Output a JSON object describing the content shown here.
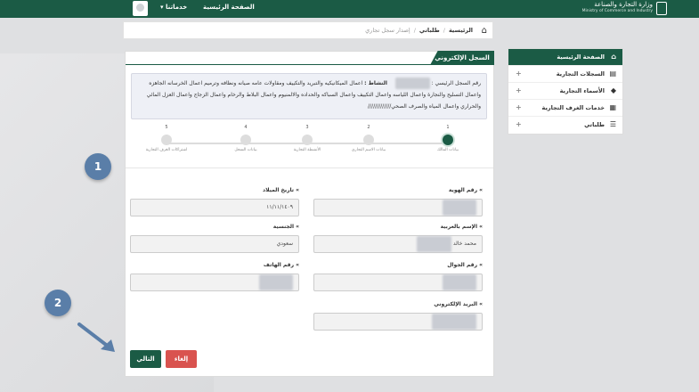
{
  "topbar": {
    "ministry_ar": "وزارة التجارة والصناعة",
    "ministry_en": "Ministry of Commerce and Industry",
    "home_label": "الصفحة الرئيسية",
    "user_menu_label": "خدماتنا"
  },
  "breadcrumb": {
    "items": [
      "الرئيسية",
      "طلباتي",
      "إصدار سجل تجاري"
    ]
  },
  "sidebar": {
    "items": [
      {
        "label": "الصفحة الرئيسية"
      },
      {
        "label": "السجلات التجارية"
      },
      {
        "label": "الأسماء التجارية"
      },
      {
        "label": "خدمات الغرف التجارية"
      },
      {
        "label": "طلباتي"
      }
    ]
  },
  "panel": {
    "title": "السجل الإلكتروني",
    "info": {
      "cr_label": "رقم السجل الرئيسي :",
      "activity_label": "النشاط :",
      "activity_text": "اعمال الميكانيكيه والتبريد والتكييف ومقاولات عامه صيانه ونظافه وترميم اعمال الخرسانه الجاهزه واعمال التسليح والنجارة واعمال اللياسه واعمال التكييف واعمال السباكه والحداده والالمنيوم واعمال البلاط والرخام واعمال الزجاج واعمال العزل المائي والحراري واعمال المياه والصرف الصحي"
    },
    "steps": [
      {
        "num": "1",
        "label": "بيانات المالك"
      },
      {
        "num": "2",
        "label": "بيانات الاسم التجاري"
      },
      {
        "num": "3",
        "label": "الأنشطة التجارية"
      },
      {
        "num": "4",
        "label": "بيانات السجل"
      },
      {
        "num": "5",
        "label": "اشتراكات الغرف التجارية"
      }
    ],
    "fields": {
      "id_number": {
        "label": "رقم الهوية",
        "value": ""
      },
      "birth_date": {
        "label": "تاريخ الميلاد",
        "value": "١١/١١/١٤٠٩"
      },
      "arabic_name": {
        "label": "الإسم بالعربية",
        "value": "محمد خالد"
      },
      "nationality": {
        "label": "الجنسية",
        "value": "سعودي"
      },
      "mobile": {
        "label": "رقم الجوال",
        "value": ""
      },
      "phone": {
        "label": "رقم الهاتف",
        "value": ""
      },
      "email": {
        "label": "البريد الإلكتروني",
        "value": ""
      }
    },
    "next_label": "التالي",
    "cancel_label": "إلغاء"
  },
  "callouts": {
    "one": "1",
    "two": "2"
  },
  "colors": {
    "brand": "#1b5b45",
    "cancel": "#d9534f",
    "callout": "#5a7ea8"
  }
}
